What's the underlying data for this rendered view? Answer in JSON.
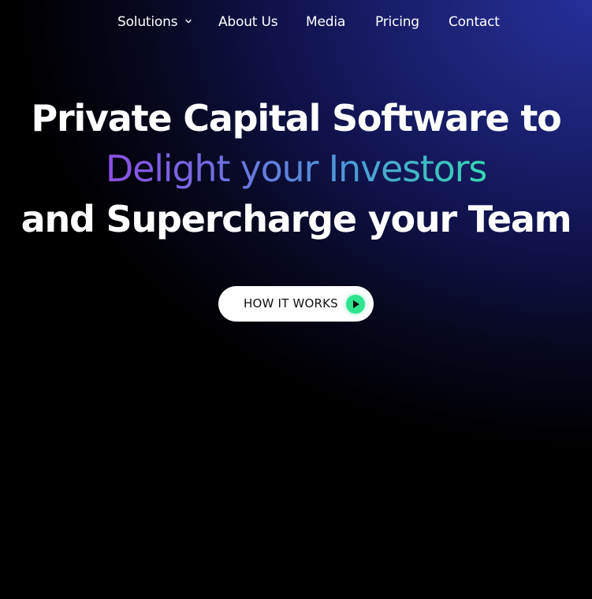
{
  "nav": {
    "items": [
      {
        "label": "Solutions",
        "has_dropdown": true,
        "icon": "chevron-down-icon"
      },
      {
        "label": "About Us"
      },
      {
        "label": "Media"
      },
      {
        "label": "Pricing"
      },
      {
        "label": "Contact"
      }
    ]
  },
  "hero": {
    "line1": "Private Capital Software to",
    "line2": "Delight your Investors",
    "line3": "and Supercharge your Team"
  },
  "cta": {
    "label": "HOW IT WORKS",
    "icon": "play-icon",
    "icon_color": "#2ee58f"
  },
  "colors": {
    "gradient_start": "#8b4fe6",
    "gradient_end": "#34d6b3",
    "background_accent": "#24309a"
  }
}
